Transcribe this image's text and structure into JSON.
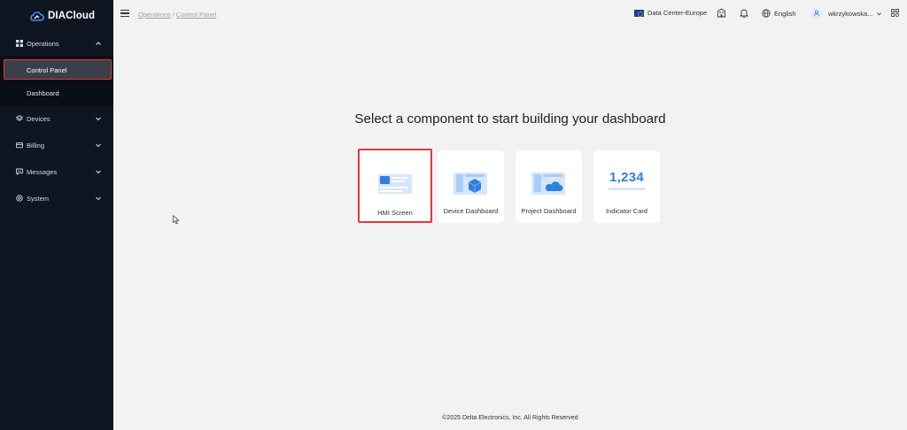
{
  "app": {
    "name": "DIACloud"
  },
  "sidebar": {
    "items": [
      {
        "label": "Operations",
        "icon": "grid-icon",
        "expanded": true
      },
      {
        "label": "Devices",
        "icon": "layers-icon",
        "expanded": false
      },
      {
        "label": "Billing",
        "icon": "billing-icon",
        "expanded": false
      },
      {
        "label": "Messages",
        "icon": "message-icon",
        "expanded": false
      },
      {
        "label": "System",
        "icon": "gear-icon",
        "expanded": false
      }
    ],
    "operations_sub": [
      {
        "label": "Control Panel",
        "active": true
      },
      {
        "label": "Dashboard",
        "active": false
      }
    ]
  },
  "header": {
    "breadcrumb": [
      "Operations",
      "Control Panel"
    ],
    "breadcrumb_sep": "/",
    "datacenter": "Data Center-Europe",
    "language": "English",
    "user": "wkrzykowska..."
  },
  "main": {
    "title": "Select a component to start building your dashboard",
    "cards": [
      {
        "label": "HMI Screen",
        "icon": "hmi-screen-icon",
        "selected": true
      },
      {
        "label": "Device Dashboard",
        "icon": "device-dashboard-icon",
        "selected": false
      },
      {
        "label": "Project Dashboard",
        "icon": "project-dashboard-icon",
        "selected": false
      },
      {
        "label": "Indicator Card",
        "icon": "indicator-card-icon",
        "value": "1,234",
        "selected": false
      }
    ]
  },
  "footer": {
    "text": "©2025 Delta Electronics, Inc. All Rights Reserved"
  },
  "colors": {
    "sidebar_bg": "#101621",
    "accent_blue": "#2f7fe0",
    "highlight_red": "#e0393b",
    "page_bg": "#f2f2f2"
  }
}
